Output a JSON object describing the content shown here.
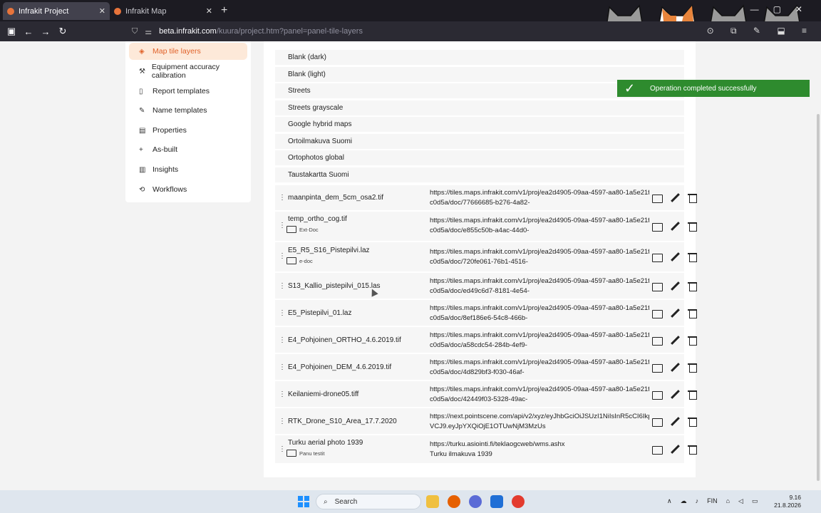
{
  "browser": {
    "tabs": [
      {
        "title": "Infrakit Project",
        "active": true
      },
      {
        "title": "Infrakit Map",
        "active": false
      }
    ],
    "new_tab_label": "+",
    "url_domain": "beta.infrakit.com",
    "url_path": "/kuura/project.htm?panel=panel-tile-layers"
  },
  "sidebar": {
    "items": [
      {
        "label": "Map tile layers",
        "icon": "layers-icon",
        "active": true
      },
      {
        "label": "Equipment accuracy calibration",
        "icon": "calibration-icon"
      },
      {
        "label": "Report templates",
        "icon": "document-icon"
      },
      {
        "label": "Name templates",
        "icon": "pencil-icon"
      },
      {
        "label": "Properties",
        "icon": "properties-icon"
      },
      {
        "label": "As-built",
        "icon": "plus-icon"
      },
      {
        "label": "Insights",
        "icon": "bar-chart-icon"
      },
      {
        "label": "Workflows",
        "icon": "workflow-icon"
      }
    ]
  },
  "base_layers": [
    "Blank (dark)",
    "Blank (light)",
    "Streets",
    "Streets grayscale",
    "Google hybrid maps",
    "Ortoilmakuva Suomi",
    "Ortophotos global",
    "Taustakartta Suomi"
  ],
  "custom_layers": [
    {
      "name": "maanpinta_dem_5cm_osa2.tif",
      "folder": "",
      "url1": "https://tiles.maps.infrakit.com/v1/proj/ea2d4905-09aa-4597-aa80-1a5e21f",
      "url2": "c0d5a/doc/77666685-b276-4a82-"
    },
    {
      "name": "temp_ortho_cog.tif",
      "folder": "Ext-Doc",
      "url1": "https://tiles.maps.infrakit.com/v1/proj/ea2d4905-09aa-4597-aa80-1a5e21f",
      "url2": "c0d5a/doc/e855c50b-a4ac-44d0-"
    },
    {
      "name": "E5_R5_S16_Pistepilvi.laz",
      "folder": "e-doc",
      "url1": "https://tiles.maps.infrakit.com/v1/proj/ea2d4905-09aa-4597-aa80-1a5e21f",
      "url2": "c0d5a/doc/720fe061-76b1-4516-"
    },
    {
      "name": "S13_Kallio_pistepilvi_015.las",
      "folder": "",
      "url1": "https://tiles.maps.infrakit.com/v1/proj/ea2d4905-09aa-4597-aa80-1a5e21f",
      "url2": "c0d5a/doc/ed49c6d7-8181-4e54-"
    },
    {
      "name": "E5_Pistepilvi_01.laz",
      "folder": "",
      "url1": "https://tiles.maps.infrakit.com/v1/proj/ea2d4905-09aa-4597-aa80-1a5e21f",
      "url2": "c0d5a/doc/8ef186e6-54c8-466b-"
    },
    {
      "name": "E4_Pohjoinen_ORTHO_4.6.2019.tif",
      "folder": "",
      "url1": "https://tiles.maps.infrakit.com/v1/proj/ea2d4905-09aa-4597-aa80-1a5e21f",
      "url2": "c0d5a/doc/a58cdc54-284b-4ef9-"
    },
    {
      "name": "E4_Pohjoinen_DEM_4.6.2019.tif",
      "folder": "",
      "url1": "https://tiles.maps.infrakit.com/v1/proj/ea2d4905-09aa-4597-aa80-1a5e21f",
      "url2": "c0d5a/doc/4d829bf3-f030-46af-"
    },
    {
      "name": "Keilaniemi-drone05.tiff",
      "folder": "",
      "url1": "https://tiles.maps.infrakit.com/v1/proj/ea2d4905-09aa-4597-aa80-1a5e21f",
      "url2": "c0d5a/doc/42449f03-5328-49ac-"
    },
    {
      "name": "RTK_Drone_S10_Area_17.7.2020",
      "folder": "",
      "url1": "https://next.pointscene.com/api/v2/xyz/eyJhbGciOiJSUzI1NiIsInR5cCI6IkpX",
      "url2": "VCJ9.eyJpYXQiOjE1OTUwNjM3MzUs"
    },
    {
      "name": "Turku aerial photo 1939",
      "folder": "Panu testit",
      "url1": "https://turku.asiointi.fi/teklaogcweb/wms.ashx",
      "url2": "Turku ilmakuva 1939"
    }
  ],
  "toast": {
    "message": "Operation completed successfully",
    "color": "#2e8b2e"
  },
  "taskbar": {
    "search_label": "Search",
    "lang": "FIN",
    "time": "9.16",
    "date": "21.8.2026"
  },
  "colors": {
    "accent": "#e0622a",
    "active_bg": "#fde9d9"
  }
}
